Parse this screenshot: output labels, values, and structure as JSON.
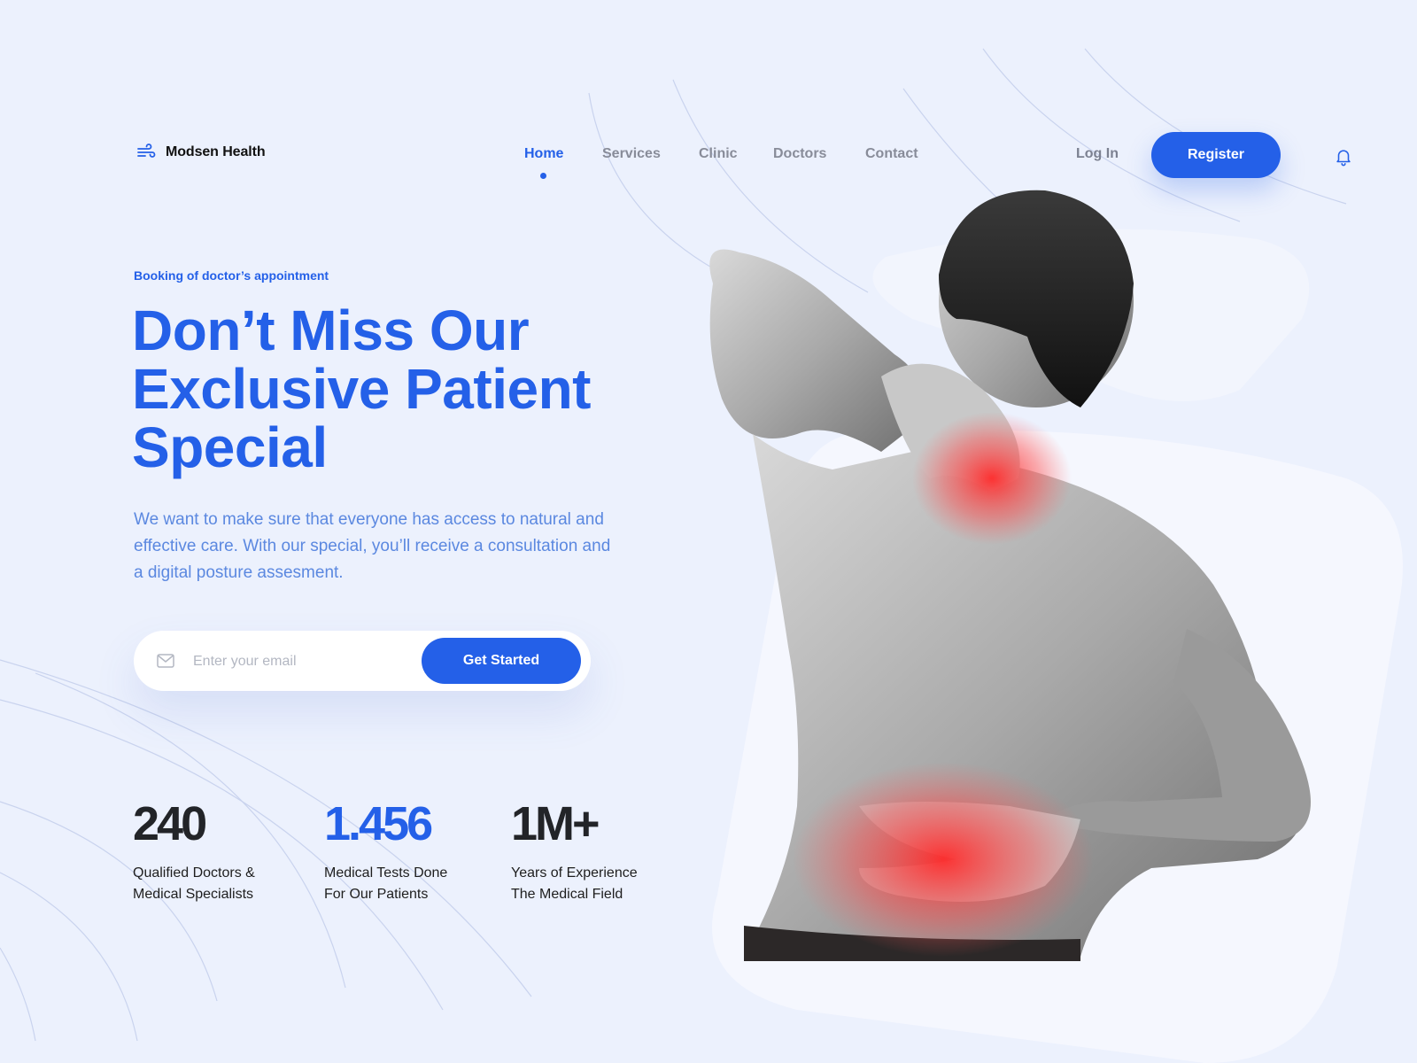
{
  "brand": {
    "name": "Modsen Health",
    "logo_icon": "wind-icon",
    "accent_color": "#2460e8",
    "background_color": "#ecf1fd"
  },
  "nav": {
    "items": [
      {
        "label": "Home",
        "active": true
      },
      {
        "label": "Services",
        "active": false
      },
      {
        "label": "Clinic",
        "active": false
      },
      {
        "label": "Doctors",
        "active": false
      },
      {
        "label": "Contact",
        "active": false
      }
    ]
  },
  "auth": {
    "login_label": "Log In",
    "register_label": "Register",
    "notification_icon": "bell-icon"
  },
  "hero": {
    "eyebrow": "Booking of doctor’s appointment",
    "headline": "Don’t Miss Our Exclusive Patient Special",
    "subtext": "We want to make sure that everyone has access to natural and effective care. With our special, you’ll receive a consultation and a digital posture assesment.",
    "email_placeholder": "Enter your email",
    "email_value": "",
    "cta_label": "Get Started",
    "image_subject": "shirtless man holding neck and lower back, pain areas highlighted red"
  },
  "stats": [
    {
      "value": "240",
      "label_line1": "Qualified Doctors &",
      "label_line2": "Medical Specialists"
    },
    {
      "value": "1.456",
      "label_line1": "Medical Tests Done",
      "label_line2": "For Our Patients"
    },
    {
      "value": "1M+",
      "label_line1": "Years of Experience",
      "label_line2": "The Medical Field"
    }
  ]
}
